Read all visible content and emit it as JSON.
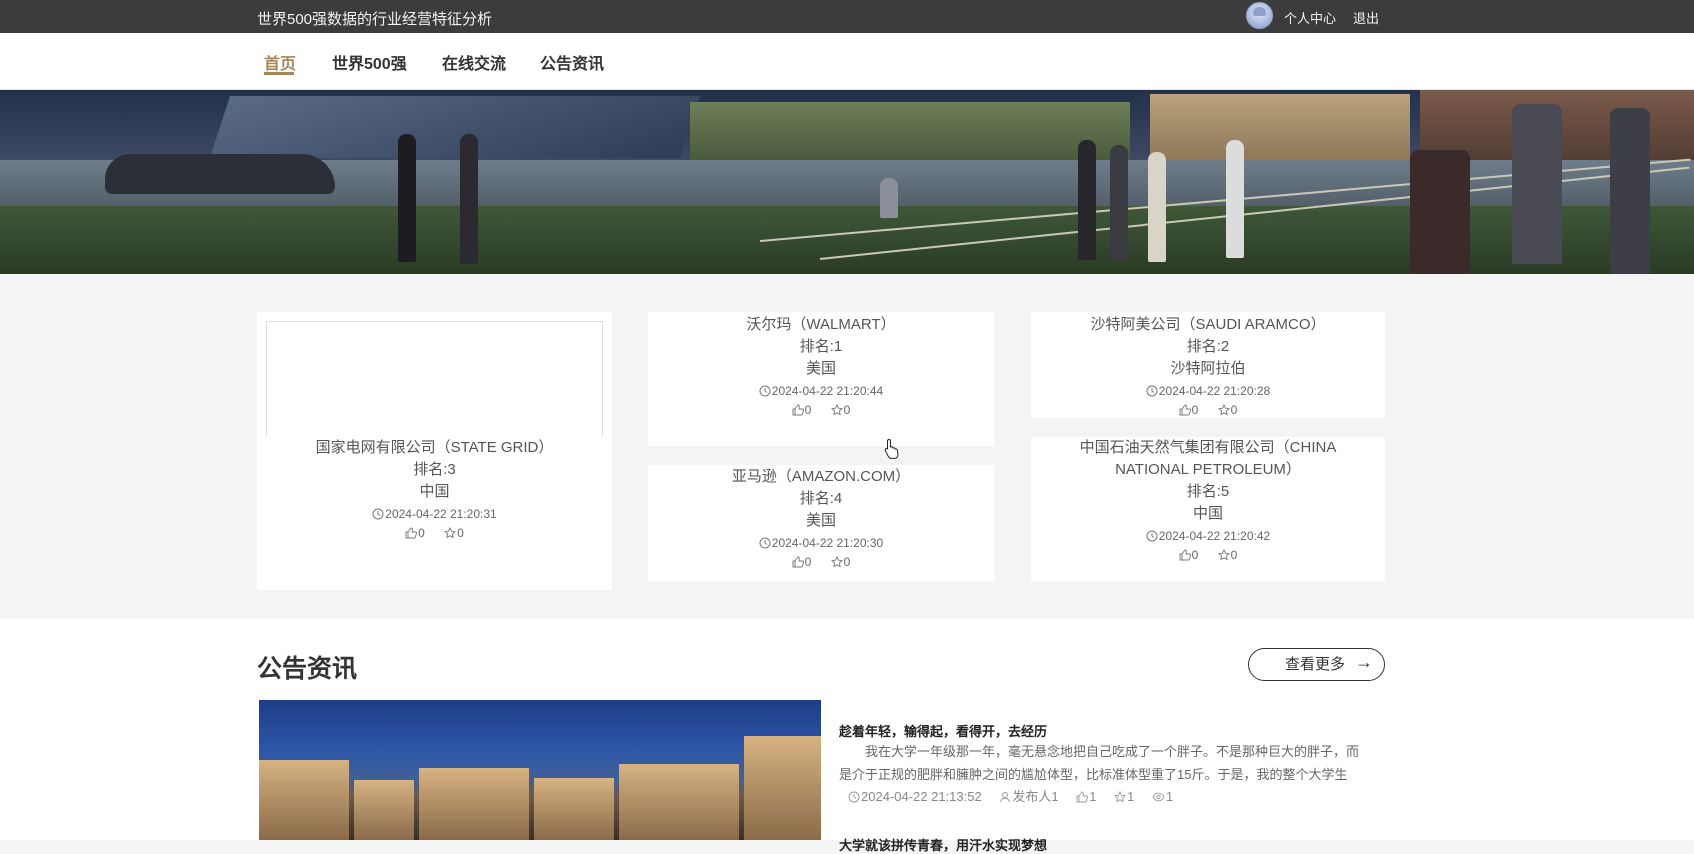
{
  "header": {
    "site_title": "世界500强数据的行业经营特征分析",
    "user_center": "个人中心",
    "logout": "退出"
  },
  "nav": {
    "items": [
      {
        "label": "首页",
        "active": true
      },
      {
        "label": "世界500强",
        "active": false
      },
      {
        "label": "在线交流",
        "active": false
      },
      {
        "label": "公告资讯",
        "active": false
      }
    ]
  },
  "cards": [
    {
      "name": "沃尔玛（WALMART）",
      "rank": "排名:1",
      "country": "美国",
      "time": "2024-04-22 21:20:44",
      "likes": "0",
      "favorites": "0"
    },
    {
      "name": "沙特阿美公司（SAUDI ARAMCO）",
      "rank": "排名:2",
      "country": "沙特阿拉伯",
      "time": "2024-04-22 21:20:28",
      "likes": "0",
      "favorites": "0"
    },
    {
      "name": "国家电网有限公司（STATE GRID）",
      "rank": "排名:3",
      "country": "中国",
      "time": "2024-04-22 21:20:31",
      "likes": "0",
      "favorites": "0"
    },
    {
      "name": "亚马逊（AMAZON.COM）",
      "rank": "排名:4",
      "country": "美国",
      "time": "2024-04-22 21:20:30",
      "likes": "0",
      "favorites": "0"
    },
    {
      "name_line1": "中国石油天然气集团有限公司（CHINA",
      "name_line2": "NATIONAL PETROLEUM）",
      "rank": "排名:5",
      "country": "中国",
      "time": "2024-04-22 21:20:42",
      "likes": "0",
      "favorites": "0"
    }
  ],
  "news": {
    "section_title": "公告资讯",
    "more_label": "查看更多",
    "items": [
      {
        "title": "趁着年轻，输得起，看得开，去经历",
        "excerpt": "我在大学一年级那一年，毫无悬念地把自己吃成了一个胖子。不是那种巨大的胖子，而是介于正规的肥胖和臃肿之间的尴尬体型，比标准体型重了15斤。于是，我的整个大学生",
        "time": "2024-04-22 21:13:52",
        "author": "发布人1",
        "likes": "1",
        "favorites": "1",
        "views": "1"
      },
      {
        "title": "大学就该拼传青春，用汗水实现梦想"
      }
    ]
  },
  "colors": {
    "accent": "#a58758",
    "topbar": "#3c3c3c"
  }
}
